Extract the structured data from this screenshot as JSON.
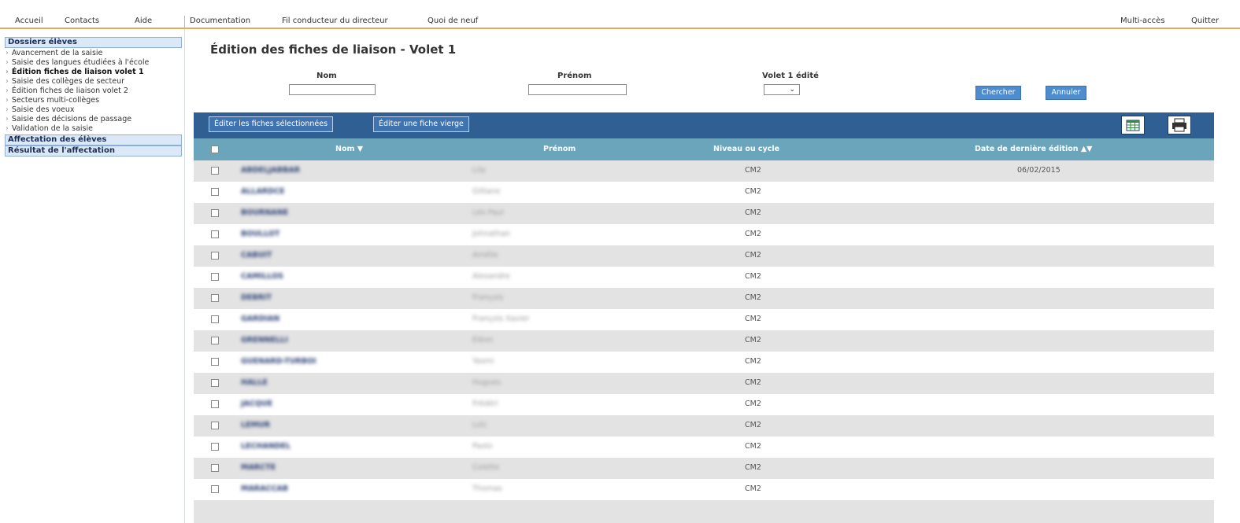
{
  "menu": {
    "left": [
      "Accueil",
      "Contacts",
      "Aide"
    ],
    "main": [
      "Documentation",
      "Fil conducteur du directeur",
      "Quoi de neuf"
    ],
    "right": [
      "Multi-accès",
      "Quitter"
    ]
  },
  "sidebar": {
    "section_dossiers": "Dossiers élèves",
    "items": [
      "Avancement de la saisie",
      "Saisie des langues étudiées à l'école",
      "Édition fiches de liaison volet 1",
      "Saisie des collèges de secteur",
      "Édition fiches de liaison volet 2",
      "Secteurs multi-collèges",
      "Saisie des voeux",
      "Saisie des décisions de passage",
      "Validation de la saisie"
    ],
    "active_index": 2,
    "section_affectation": "Affectation des élèves",
    "section_resultat": "Résultat de l'affectation"
  },
  "page": {
    "title": "Édition des fiches de liaison - Volet 1"
  },
  "filters": {
    "nom_label": "Nom",
    "prenom_label": "Prénom",
    "volet_label": "Volet 1 édité",
    "volet_value": "",
    "chercher": "Chercher",
    "annuler": "Annuler"
  },
  "toolbar": {
    "edit_selected": "Éditer les fiches sélectionnées",
    "edit_blank": "Éditer une fiche vierge"
  },
  "icons": {
    "calendar": "calendar-icon",
    "print": "printer-icon"
  },
  "table": {
    "headers": {
      "nom": "Nom",
      "prenom": "Prénom",
      "niveau": "Niveau ou cycle",
      "date": "Date de dernière édition"
    },
    "rows": [
      {
        "nom": "ABDELJABBAR",
        "prenom": "Lila",
        "niveau": "CM2",
        "date": "06/02/2015"
      },
      {
        "nom": "ALLARDCE",
        "prenom": "Gilliane",
        "niveau": "CM2",
        "date": ""
      },
      {
        "nom": "BOURNANE",
        "prenom": "Léo Paul",
        "niveau": "CM2",
        "date": ""
      },
      {
        "nom": "BOULLOT",
        "prenom": "Johnathan",
        "niveau": "CM2",
        "date": ""
      },
      {
        "nom": "CABUIT",
        "prenom": "Amélie",
        "niveau": "CM2",
        "date": ""
      },
      {
        "nom": "CAMILLOS",
        "prenom": "Alexandre",
        "niveau": "CM2",
        "date": ""
      },
      {
        "nom": "DEBRIT",
        "prenom": "François",
        "niveau": "CM2",
        "date": ""
      },
      {
        "nom": "GARDIAN",
        "prenom": "François Xavier",
        "niveau": "CM2",
        "date": ""
      },
      {
        "nom": "GRENNELLI",
        "prenom": "Eléon",
        "niveau": "CM2",
        "date": ""
      },
      {
        "nom": "GUENARD-TURBOI",
        "prenom": "Yasmi",
        "niveau": "CM2",
        "date": ""
      },
      {
        "nom": "HALLE",
        "prenom": "Hugues",
        "niveau": "CM2",
        "date": ""
      },
      {
        "nom": "JACQUE",
        "prenom": "Frédéri",
        "niveau": "CM2",
        "date": ""
      },
      {
        "nom": "LEMUR",
        "prenom": "Loïc",
        "niveau": "CM2",
        "date": ""
      },
      {
        "nom": "LECHANDEL",
        "prenom": "Paolo",
        "niveau": "CM2",
        "date": ""
      },
      {
        "nom": "MARCTE",
        "prenom": "Colette",
        "niveau": "CM2",
        "date": ""
      },
      {
        "nom": "MARACCAB",
        "prenom": "Thomas",
        "niveau": "CM2",
        "date": ""
      }
    ]
  }
}
